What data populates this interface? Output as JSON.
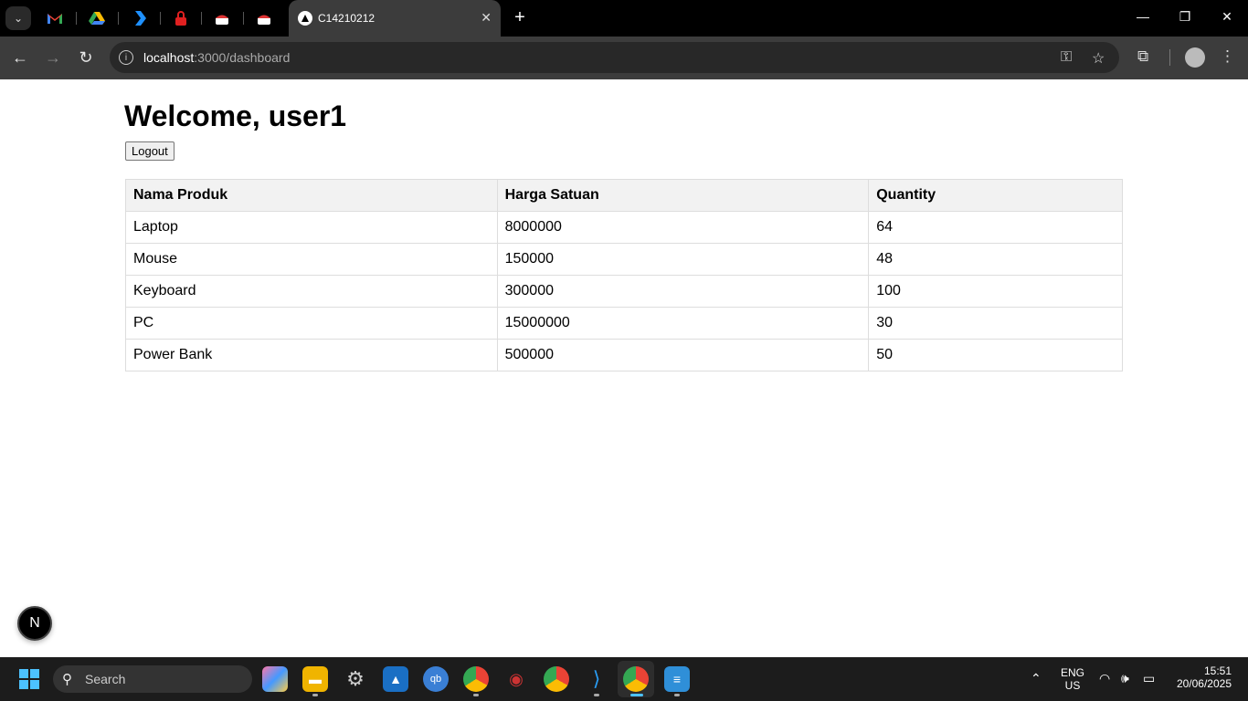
{
  "browser": {
    "active_tab_title": "C14210212",
    "url_host": "localhost",
    "url_path": ":3000/dashboard"
  },
  "page": {
    "heading": "Welcome, user1",
    "logout_label": "Logout",
    "table": {
      "headers": [
        "Nama Produk",
        "Harga Satuan",
        "Quantity"
      ],
      "rows": [
        [
          "Laptop",
          "8000000",
          "64"
        ],
        [
          "Mouse",
          "150000",
          "48"
        ],
        [
          "Keyboard",
          "300000",
          "100"
        ],
        [
          "PC",
          "15000000",
          "30"
        ],
        [
          "Power Bank",
          "500000",
          "50"
        ]
      ]
    },
    "dev_badge": "N"
  },
  "taskbar": {
    "search_label": "Search",
    "lang_top": "ENG",
    "lang_bottom": "US",
    "time": "15:51",
    "date": "20/06/2025"
  },
  "colors": {
    "chrome_bg": "#000000",
    "toolbar_bg": "#3c3c3c",
    "table_header_bg": "#f2f2f2",
    "table_border": "#dddddd",
    "taskbar_bg": "#1c1c1c"
  }
}
